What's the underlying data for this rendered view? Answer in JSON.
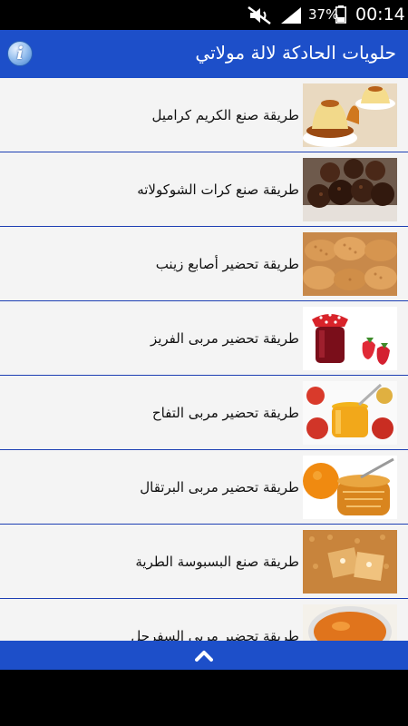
{
  "status_bar": {
    "battery_percent": "37%",
    "time": "00:14",
    "icons": [
      "mute-icon",
      "signal-icon",
      "battery-icon"
    ]
  },
  "app_bar": {
    "title": "حلويات الحادكة لالة مولاتي",
    "info_icon": "info-icon"
  },
  "recipes": [
    {
      "label": "طريقة صنع الكريم كراميل",
      "thumb": "creme-caramel-image"
    },
    {
      "label": "طريقة صنع كرات الشوكولاته",
      "thumb": "chocolate-balls-image"
    },
    {
      "label": "طريقة تحضير أصابع زينب",
      "thumb": "zainab-fingers-image"
    },
    {
      "label": "طريقة تحضير مربى الفريز",
      "thumb": "strawberry-jam-image"
    },
    {
      "label": "طريقة تحضير مربى التفاح",
      "thumb": "apple-jam-image"
    },
    {
      "label": "طريقة تحضير مربى البرتقال",
      "thumb": "orange-jam-image"
    },
    {
      "label": "طريقة صنع البسبوسة الطرية",
      "thumb": "basbousa-image"
    },
    {
      "label": "طريقة تحضير مربى السفرجل",
      "thumb": "quince-jam-image"
    }
  ],
  "bottom_bar": {
    "icon": "chevron-up-icon"
  },
  "colors": {
    "app_bar": "#1d4fc9",
    "divider": "#1d3fb3",
    "list_bg": "#f4f4f4"
  }
}
